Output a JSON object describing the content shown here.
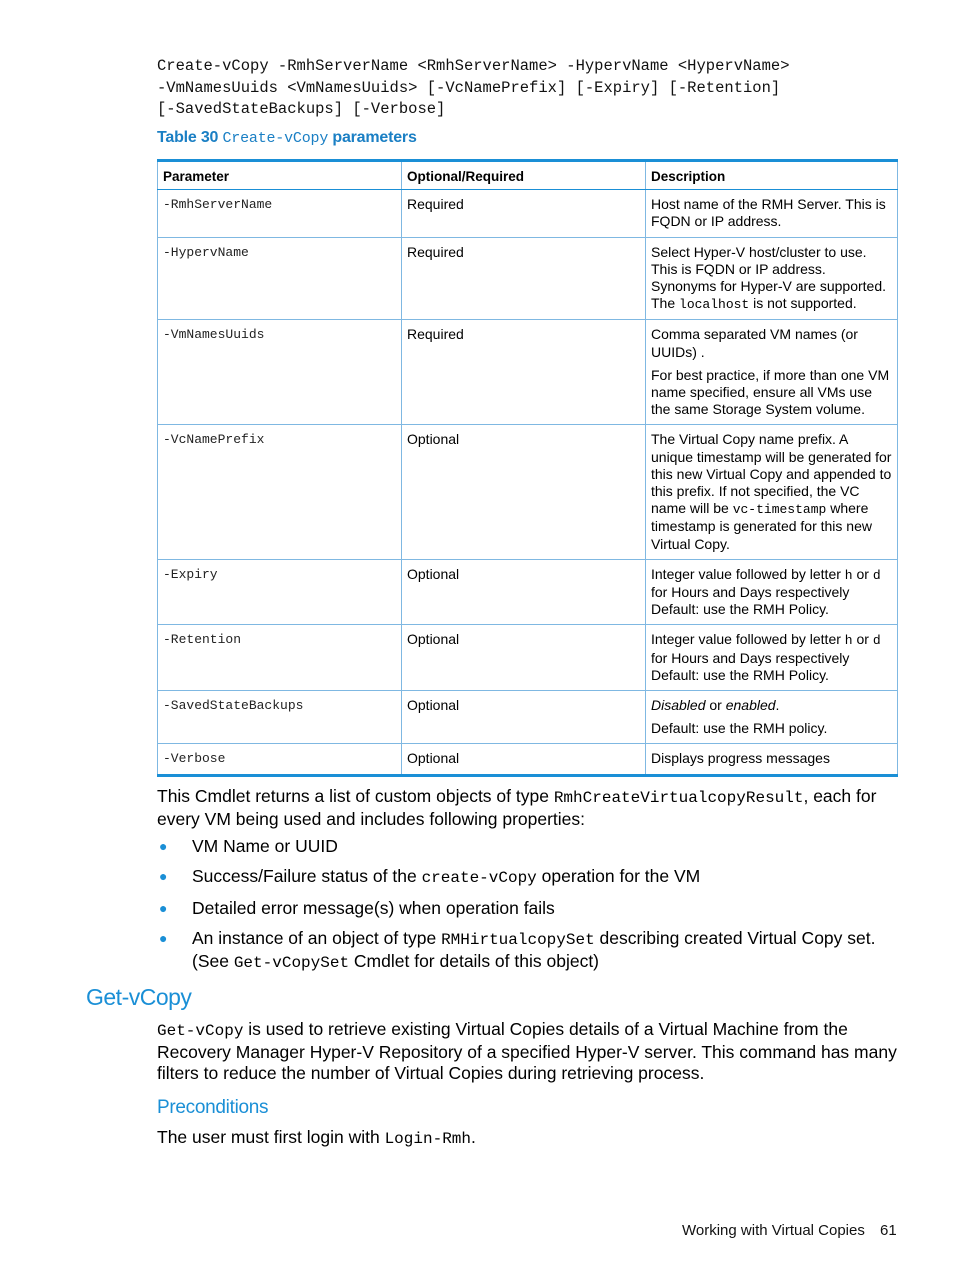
{
  "syntax": {
    "lines": [
      "Create-vCopy -RmhServerName <RmhServerName> -HypervName <HypervName>",
      "-VmNamesUuids <VmNamesUuids> [-VcNamePrefix] [-Expiry] [-Retention]",
      "[-SavedStateBackups] [-Verbose]"
    ]
  },
  "table": {
    "caption_prefix": "Table 30",
    "caption_code": "Create-vCopy",
    "caption_suffix": "parameters",
    "headers": [
      "Parameter",
      "Optional/Required",
      "Description"
    ],
    "rows": [
      {
        "param": "-RmhServerName",
        "req": "Required",
        "desc": [
          {
            "parts": [
              {
                "t": "Host name of the RMH Server. This is FQDN or IP address."
              }
            ]
          }
        ]
      },
      {
        "param": "-HypervName",
        "req": "Required",
        "desc": [
          {
            "parts": [
              {
                "t": "Select Hyper-V host/cluster to use. This is FQDN or IP address. Synonyms for Hyper-V are supported. The "
              },
              {
                "t": "localhost",
                "code": true
              },
              {
                "t": " is not supported."
              }
            ]
          }
        ]
      },
      {
        "param": "-VmNamesUuids",
        "req": "Required",
        "desc": [
          {
            "parts": [
              {
                "t": "Comma separated VM names (or UUIDs) ."
              }
            ]
          },
          {
            "parts": [
              {
                "t": "For best practice, if more than one VM name specified, ensure all VMs use the same Storage System volume."
              }
            ]
          }
        ]
      },
      {
        "param": "-VcNamePrefix",
        "req": "Optional",
        "desc": [
          {
            "parts": [
              {
                "t": "The Virtual Copy name prefix. A unique timestamp will be generated for this new Virtual Copy and appended to this prefix. If not specified, the VC name will be "
              },
              {
                "t": "vc-timestamp",
                "code": true
              },
              {
                "t": " where timestamp is generated for this new Virtual Copy."
              }
            ]
          }
        ]
      },
      {
        "param": "-Expiry",
        "req": "Optional",
        "desc": [
          {
            "parts": [
              {
                "t": "Integer value followed by letter "
              },
              {
                "t": "h",
                "code": true
              },
              {
                "t": " or "
              },
              {
                "t": "d",
                "code": true
              },
              {
                "t": " for Hours and Days respectively Default: use the RMH Policy."
              }
            ]
          }
        ]
      },
      {
        "param": "-Retention",
        "req": "Optional",
        "desc": [
          {
            "parts": [
              {
                "t": "Integer value followed by letter "
              },
              {
                "t": "h",
                "code": true
              },
              {
                "t": " or "
              },
              {
                "t": "d",
                "code": true
              },
              {
                "t": " for Hours and Days respectively Default: use the RMH Policy."
              }
            ]
          }
        ]
      },
      {
        "param": "-SavedStateBackups",
        "req": "Optional",
        "desc": [
          {
            "parts": [
              {
                "t": "Disabled",
                "em": true
              },
              {
                "t": " or "
              },
              {
                "t": "enabled",
                "em": true
              },
              {
                "t": "."
              }
            ]
          },
          {
            "parts": [
              {
                "t": "Default: use the RMH policy."
              }
            ]
          }
        ]
      },
      {
        "param": "-Verbose",
        "req": "Optional",
        "desc": [
          {
            "parts": [
              {
                "t": "Displays progress messages"
              }
            ]
          }
        ]
      }
    ]
  },
  "returns": {
    "text_before": "This Cmdlet returns a list of custom objects of type ",
    "code": "RmhCreateVirtualcopyResult",
    "text_after": ", each for every VM being used and includes following properties:"
  },
  "properties": [
    {
      "parts": [
        {
          "t": "VM Name or UUID"
        }
      ]
    },
    {
      "parts": [
        {
          "t": "Success/Failure status of the "
        },
        {
          "t": "create-vCopy",
          "code": true
        },
        {
          "t": " operation for the VM"
        }
      ]
    },
    {
      "parts": [
        {
          "t": "Detailed error message(s) when operation fails"
        }
      ]
    },
    {
      "parts": [
        {
          "t": "An instance of an object of type "
        },
        {
          "t": "RMHirtualcopySet",
          "code": true
        },
        {
          "t": " describing created Virtual Copy set. (See "
        },
        {
          "t": "Get-vCopySet",
          "code": true
        },
        {
          "t": " Cmdlet for details of this object)"
        }
      ]
    }
  ],
  "section": {
    "title": "Get-vCopy",
    "intro_code": "Get-vCopy",
    "intro_text": " is used to retrieve existing Virtual Copies details of a Virtual Machine from the Recovery Manager Hyper-V Repository of a specified Hyper-V server. This command has many filters to reduce the number of Virtual Copies during retrieving process.",
    "subsection_title": "Preconditions",
    "precondition_text": "The user must first login with ",
    "precondition_code": "Login-Rmh",
    "precondition_end": "."
  },
  "footer": {
    "chapter": "Working with Virtual Copies",
    "page": "61"
  },
  "colors": {
    "accent": "#1a8fd6",
    "grid": "#7fb8e2"
  }
}
